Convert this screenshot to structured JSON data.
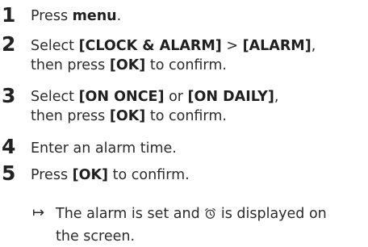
{
  "steps": [
    {
      "number": "1",
      "parts": [
        "Press ",
        "menu",
        "."
      ]
    },
    {
      "number": "2",
      "line1": [
        "Select ",
        "[CLOCK & ALARM]",
        " > ",
        "[ALARM]",
        ","
      ],
      "line2": [
        "then press ",
        "[OK]",
        " to confirm."
      ]
    },
    {
      "number": "3",
      "line1": [
        "Select ",
        "[ON ONCE]",
        " or ",
        "[ON DAILY]",
        ","
      ],
      "line2": [
        "then press ",
        "[OK]",
        " to confirm."
      ]
    },
    {
      "number": "4",
      "parts": [
        "Enter an alarm time."
      ]
    },
    {
      "number": "5",
      "parts": [
        "Press ",
        "[OK]",
        " to confirm."
      ]
    }
  ],
  "result": {
    "arrow": "↦",
    "before_icon": "The alarm is set and",
    "after_icon": "is displayed on",
    "line2": "the screen.",
    "icon": "alarm-clock-icon"
  }
}
